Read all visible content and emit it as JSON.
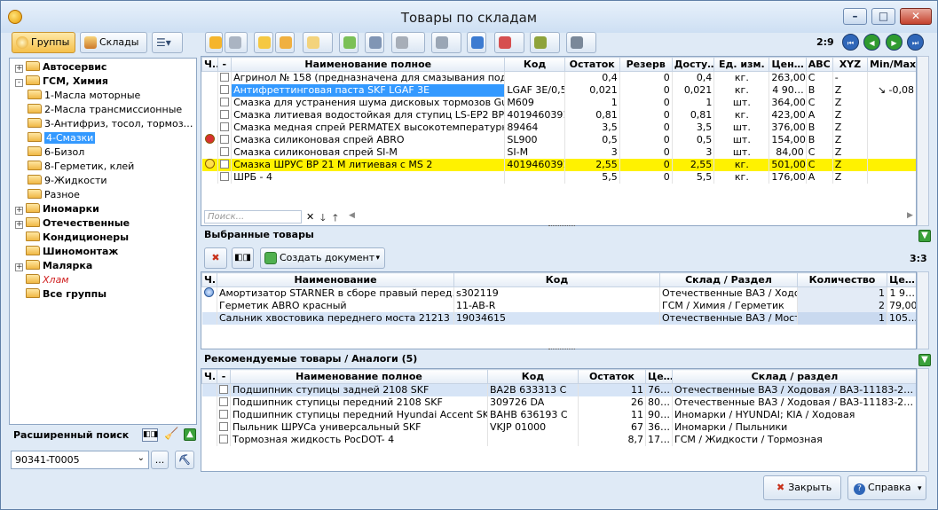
{
  "window": {
    "title": "Товары по складам"
  },
  "left_tabs": {
    "groups": "Группы",
    "warehouses": "Склады"
  },
  "tree": [
    {
      "label": "Автосервис",
      "level": 0,
      "bold": true,
      "expander": "+"
    },
    {
      "label": "ГСМ, Химия",
      "level": 0,
      "bold": true,
      "expander": "-"
    },
    {
      "label": "1-Масла моторные",
      "level": 1
    },
    {
      "label": "2-Масла трансмиссионные",
      "level": 1
    },
    {
      "label": "3-Антифриз, тосол, тормоз…",
      "level": 1
    },
    {
      "label": "4-Смазки",
      "level": 1,
      "selected": true
    },
    {
      "label": "6-Бизол",
      "level": 1
    },
    {
      "label": "8-Герметик, клей",
      "level": 1
    },
    {
      "label": "9-Жидкости",
      "level": 1
    },
    {
      "label": "Разное",
      "level": 1
    },
    {
      "label": "Иномарки",
      "level": 0,
      "bold": true,
      "expander": "+"
    },
    {
      "label": "Отечественные",
      "level": 0,
      "bold": true,
      "expander": "+"
    },
    {
      "label": "Кондиционеры",
      "level": 0,
      "bold": true
    },
    {
      "label": "Шиномонтаж",
      "level": 0,
      "bold": true
    },
    {
      "label": "Малярка",
      "level": 0,
      "bold": true,
      "expander": "+"
    },
    {
      "label": "Хлам",
      "level": 0,
      "italic_red": true
    },
    {
      "label": "Все группы",
      "level": 0,
      "bold": true
    }
  ],
  "ext_search": {
    "title": "Расширенный поиск",
    "value": "90341-T0005",
    "more": "..."
  },
  "toolbar": {
    "counter": "2:9"
  },
  "products": {
    "headers": [
      "Ч..",
      "-",
      "Наименование полное",
      "Код",
      "Остаток",
      "Резерв",
      "Досту…",
      "Ед. изм.",
      "Цен…",
      "ABC",
      "XYZ",
      "Min/Max"
    ],
    "rows": [
      {
        "name": "Агринол № 158  (предназначена для смазывания под…",
        "code": "",
        "stock": "0,4",
        "reserve": "0",
        "avail": "0,4",
        "unit": "кг.",
        "price": "263,00",
        "abc": "C",
        "xyz": "-",
        "minmax": "",
        "mark": ""
      },
      {
        "name": "Антифреттинговая паста SKF LGAF 3E",
        "code": "LGAF 3E/0,5",
        "stock": "0,021",
        "reserve": "0",
        "avail": "0,021",
        "unit": "кг.",
        "price": "4 90…",
        "abc": "B",
        "xyz": "Z",
        "minmax": "↘ -0,08",
        "mark": "",
        "selected": true
      },
      {
        "name": "Смазка для устранения шума дисковых тормозов Gunk c",
        "code": "M609",
        "stock": "1",
        "reserve": "0",
        "avail": "1",
        "unit": "шт.",
        "price": "364,00",
        "abc": "C",
        "xyz": "Z",
        "minmax": "",
        "mark": ""
      },
      {
        "name": "Смазка литиевая водостойкая для ступиц  LS-EP2  BP …",
        "code": "4019460391",
        "stock": "0,81",
        "reserve": "0",
        "avail": "0,81",
        "unit": "кг.",
        "price": "423,00",
        "abc": "A",
        "xyz": "Z",
        "minmax": "",
        "mark": ""
      },
      {
        "name": "Смазка медная спрей PERMATEX высокотемпературная",
        "code": "89464",
        "stock": "3,5",
        "reserve": "0",
        "avail": "3,5",
        "unit": "шт.",
        "price": "376,00",
        "abc": "B",
        "xyz": "Z",
        "minmax": "",
        "mark": ""
      },
      {
        "name": "Смазка силиконовая спрей  ABRO",
        "code": "SL900",
        "stock": "0,5",
        "reserve": "0",
        "avail": "0,5",
        "unit": "шт.",
        "price": "154,00",
        "abc": "B",
        "xyz": "Z",
        "minmax": "",
        "mark": "red"
      },
      {
        "name": "Смазка силиконовая спрей SI-M",
        "code": "SI-M",
        "stock": "3",
        "reserve": "0",
        "avail": "3",
        "unit": "шт.",
        "price": "84,00",
        "abc": "C",
        "xyz": "Z",
        "minmax": "",
        "mark": ""
      },
      {
        "name": "Смазка ШРУС  BP 21 M литиевая с MS 2",
        "code": "4019460391",
        "stock": "2,55",
        "reserve": "0",
        "avail": "2,55",
        "unit": "кг.",
        "price": "501,00",
        "abc": "C",
        "xyz": "Z",
        "minmax": "",
        "mark": "yellow",
        "highlight": true
      },
      {
        "name": "ШРБ - 4",
        "code": "",
        "stock": "5,5",
        "reserve": "0",
        "avail": "5,5",
        "unit": "кг.",
        "price": "176,00",
        "abc": "A",
        "xyz": "Z",
        "minmax": "",
        "mark": ""
      }
    ],
    "search_placeholder": "Поиск..."
  },
  "selected": {
    "title": "Выбранные товары",
    "counter": "3:3",
    "create_doc": "Создать документ",
    "headers": [
      "Ч..",
      "Наименование",
      "Код",
      "Склад / Раздел",
      "Количество",
      "Це…"
    ],
    "rows": [
      {
        "name": "Амортизатор STARNER в сборе правый перед. ма…",
        "code": "s302119",
        "wh": "Отечественные ВАЗ / Ходово…",
        "qty": "1",
        "price": "1 9…",
        "mark": "blue"
      },
      {
        "name": "Герметик ABRO красный",
        "code": "11-AB-R",
        "wh": "ГСМ / Химия / Герметик",
        "qty": "2",
        "price": "79,00",
        "mark": ""
      },
      {
        "name": "Сальник хвостовика переднего моста 21213 Cort…",
        "code": "19034615",
        "wh": "Отечественные ВАЗ / Мост…",
        "qty": "1",
        "price": "105…",
        "mark": "",
        "selected": true
      }
    ]
  },
  "recommended": {
    "title": "Рекомендуемые товары / Аналоги (5)",
    "headers": [
      "Ч..",
      "-",
      "Наименование полное",
      "Код",
      "Остаток",
      "Це…",
      "Склад / раздел"
    ],
    "rows": [
      {
        "name": "Подшипник ступицы задней 2108 SKF",
        "code": "BA2B 633313 C",
        "stock": "11",
        "price": "76…",
        "wh": "Отечественные ВАЗ / Ходовая / ВАЗ-11183-2…",
        "selected": true
      },
      {
        "name": "Подшипник ступицы передний 2108 SKF",
        "code": "309726 DA",
        "stock": "26",
        "price": "80…",
        "wh": "Отечественные ВАЗ / Ходовая / ВАЗ-11183-2…"
      },
      {
        "name": "Подшипник ступицы передний  Hyundai Accent  SKF",
        "code": "BAHB 636193 C",
        "stock": "11",
        "price": "90…",
        "wh": "Иномарки / HYUNDAI; KIA / Ходовая"
      },
      {
        "name": "Пыльник ШРУСа универсальный SKF",
        "code": "VKJP 01000",
        "stock": "67",
        "price": "36…",
        "wh": "Иномарки / Пыльники"
      },
      {
        "name": "Тормозная жидкость PocDOT- 4",
        "code": "",
        "stock": "8,7",
        "price": "17…",
        "wh": "ГСМ / Жидкости / Тормозная"
      }
    ]
  },
  "footer": {
    "close": "Закрыть",
    "help": "Справка"
  },
  "colors": {
    "selection": "#3399ff",
    "highlight": "#fff200",
    "accent_green": "#3aa13a"
  }
}
